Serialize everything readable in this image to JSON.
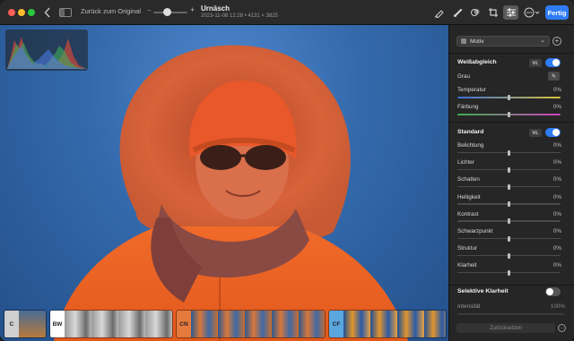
{
  "toolbar": {
    "revert_label": "Zurück zum Original",
    "doc_title": "Urnäsch",
    "doc_meta": "2023-11-08 12:28 • 4131 × 3825",
    "zoom_minus": "−",
    "zoom_plus": "+",
    "done_label": "Fertig",
    "icons": [
      "back-chevron",
      "sidebar-toggle",
      "markup-pen",
      "retouch-brush",
      "filters",
      "crop",
      "adjust-sliders",
      "more-ellipsis"
    ]
  },
  "filmstrip": {
    "groups": [
      {
        "tag": "C",
        "color": "#cfcfcf"
      },
      {
        "tag": "BW",
        "color": "#ffffff"
      },
      {
        "tag": "CN",
        "color": "#e67a3c"
      },
      {
        "tag": "CF",
        "color": "#5aa7e0"
      }
    ]
  },
  "panel": {
    "motiv_label": "Motiv",
    "add_symbol": "+",
    "white_balance": {
      "title": "Weißabgleich",
      "ml_badge": "ML",
      "enabled": true,
      "grau_label": "Grau",
      "temperatur_label": "Temperatur",
      "temperatur_value": "0%",
      "faerbung_label": "Färbung",
      "faerbung_value": "0%"
    },
    "standard": {
      "title": "Standard",
      "ml_badge": "ML",
      "enabled": true,
      "rows": [
        {
          "label": "Belichtung",
          "value": "0%"
        },
        {
          "label": "Lichter",
          "value": "0%"
        },
        {
          "label": "Schatten",
          "value": "0%"
        },
        {
          "label": "Helligkeit",
          "value": "0%"
        },
        {
          "label": "Kontrast",
          "value": "0%"
        },
        {
          "label": "Schwarzpunkt",
          "value": "0%"
        },
        {
          "label": "Struktur",
          "value": "0%"
        },
        {
          "label": "Klarheit",
          "value": "0%"
        }
      ]
    },
    "selective_clarity": {
      "title": "Selektive Klarheit",
      "enabled": false,
      "intensity_label": "Intensität",
      "intensity_value": "100%"
    },
    "reset_label": "Zurücksetzen",
    "more_symbol": "···"
  },
  "colors": {
    "accent": "#2f7cf6",
    "mask_overlay": "#e8552a",
    "sky": "#3369ab"
  }
}
